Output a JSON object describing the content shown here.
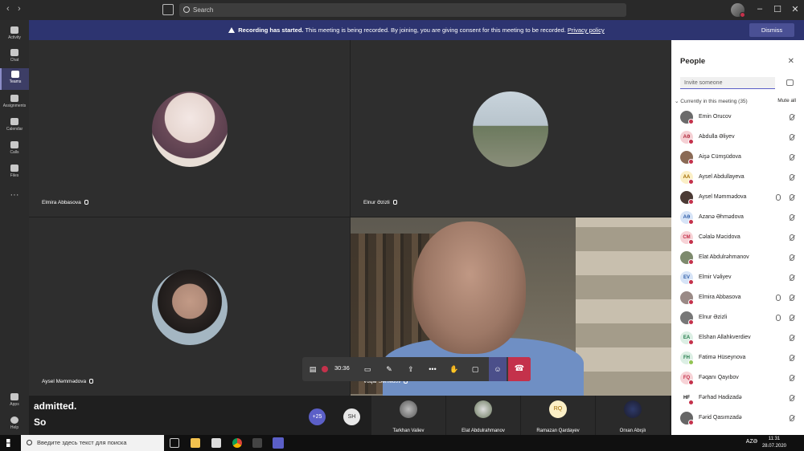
{
  "titlebar": {
    "back": "‹",
    "forward": "›",
    "search_placeholder": "Search",
    "minimize": "–",
    "maximize": "☐",
    "close": "✕"
  },
  "rail": [
    {
      "label": "Activity",
      "icon": "bell-icon"
    },
    {
      "label": "Chat",
      "icon": "chat-icon"
    },
    {
      "label": "Teams",
      "icon": "teams-icon",
      "active": true
    },
    {
      "label": "Assignments",
      "icon": "assignments-icon"
    },
    {
      "label": "Calendar",
      "icon": "calendar-icon"
    },
    {
      "label": "Calls",
      "icon": "phone-icon"
    },
    {
      "label": "Files",
      "icon": "file-icon"
    },
    {
      "label": "···",
      "icon": "more-icon"
    }
  ],
  "rail_bottom": [
    {
      "label": "Apps",
      "icon": "apps-icon"
    },
    {
      "label": "Help",
      "icon": "help-icon"
    }
  ],
  "banner": {
    "bold": "Recording has started.",
    "text": " This meeting is being recorded. By joining, you are giving consent for this meeting to be recorded.",
    "link": "Privacy policy",
    "dismiss": "Dismiss"
  },
  "tiles": [
    {
      "name": "Elmira Abbasova"
    },
    {
      "name": "Elnur Əzizli"
    },
    {
      "name": "Aysel Məmmədova"
    },
    {
      "name": "Vuqar Səmədov"
    }
  ],
  "controls": {
    "timer": "30:36",
    "more": "•••"
  },
  "caption": {
    "line1": "admitted.",
    "line2": "So"
  },
  "strip": {
    "overflow": "+25",
    "sh": "SH",
    "tiles": [
      {
        "name": "Tarkhan Valiev",
        "initials": ""
      },
      {
        "name": "Elat Abdulrahmanov",
        "initials": ""
      },
      {
        "name": "Ramazan Qardayev",
        "initials": "RQ"
      },
      {
        "name": "Orxan Abışlı",
        "initials": ""
      }
    ]
  },
  "panel": {
    "title": "People",
    "invite_placeholder": "Invite someone",
    "section": "Currently in this meeting (35)",
    "mute_all": "Mute all",
    "people": [
      {
        "name": "Emin Orucov",
        "initials": "",
        "bg": "#6b6b6b",
        "fg": "#fff",
        "on": false
      },
      {
        "name": "Abdulla Əliyev",
        "initials": "AƏ",
        "bg": "#f5d0d4",
        "fg": "#b0283a",
        "on": false
      },
      {
        "name": "Aişə Cümşüdova",
        "initials": "",
        "bg": "#8a6a55",
        "fg": "#fff",
        "on": false
      },
      {
        "name": "Aysel Abdullayeva",
        "initials": "AA",
        "bg": "#fbefc6",
        "fg": "#a26b00",
        "on": false
      },
      {
        "name": "Aysel Məmmədova",
        "initials": "",
        "bg": "#4a3a34",
        "fg": "#fff",
        "on": false,
        "extra": true
      },
      {
        "name": "Azanə Əhmədova",
        "initials": "AƏ",
        "bg": "#d7e4f7",
        "fg": "#2f5ea8",
        "on": false
      },
      {
        "name": "Cəlalə Məcidova",
        "initials": "CM",
        "bg": "#f7d3d7",
        "fg": "#c4314b",
        "on": false
      },
      {
        "name": "Elat Abdulrəhmanov",
        "initials": "",
        "bg": "#7d8a6d",
        "fg": "#fff",
        "on": false
      },
      {
        "name": "Elmir Vəliyev",
        "initials": "EV",
        "bg": "#d7e4f7",
        "fg": "#2f5ea8",
        "on": false
      },
      {
        "name": "Elmira Abbasova",
        "initials": "",
        "bg": "#9a8a86",
        "fg": "#fff",
        "on": false,
        "extra": true
      },
      {
        "name": "Elnur Əzizli",
        "initials": "",
        "bg": "#777",
        "fg": "#fff",
        "on": false,
        "extra": true
      },
      {
        "name": "Elshan Allahkverdiev",
        "initials": "EA",
        "bg": "#dcefe4",
        "fg": "#237b4b",
        "on": false
      },
      {
        "name": "Fatimə Hüseynova",
        "initials": "FH",
        "bg": "#dcefe4",
        "fg": "#237b4b",
        "on": true
      },
      {
        "name": "Fəqanı Qayıbov",
        "initials": "FQ",
        "bg": "#f7d3d7",
        "fg": "#c4314b",
        "on": false
      },
      {
        "name": "Fərhad Hadizadə",
        "initials": "HF",
        "bg": "#fff",
        "fg": "#111",
        "on": false
      },
      {
        "name": "Fərid Qasımzadə",
        "initials": "",
        "bg": "#666",
        "fg": "#fff",
        "on": false
      }
    ]
  },
  "taskbar": {
    "search_placeholder": "Введите здесь текст для поиска",
    "lang": "AZƏ",
    "time": "11:31",
    "date": "28.07.2020"
  }
}
